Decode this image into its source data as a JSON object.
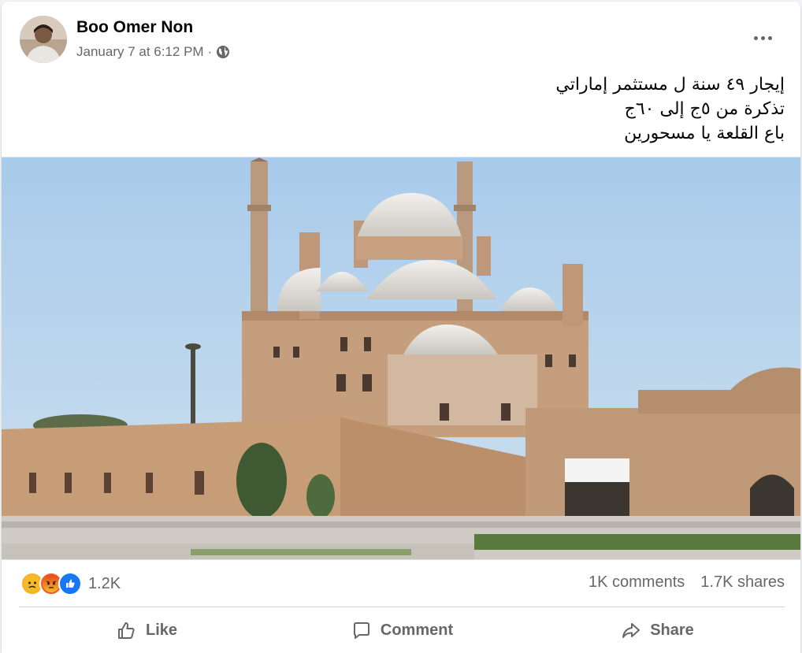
{
  "post": {
    "author": "Boo Omer Non",
    "date": "January 7 at 6:12 PM",
    "separator": "·",
    "privacy_icon": "globe-icon",
    "text_lines": [
      "إيجار ٤٩ سنة ل مستثمر إماراتي",
      "تذكرة من ٥ج إلى ٦٠ج",
      "باع القلعة يا مسحورين"
    ],
    "photo": {
      "subject": "mosque-photo"
    }
  },
  "stats": {
    "reaction_icons": [
      "sad-reaction-icon",
      "angry-reaction-icon",
      "like-reaction-icon"
    ],
    "reaction_count": "1.2K",
    "comments": "1K comments",
    "shares": "1.7K shares"
  },
  "actions": {
    "like": "Like",
    "comment": "Comment",
    "share": "Share"
  },
  "colors": {
    "secondary_text": "#65676b",
    "like_blue": "#1877f2",
    "sky": "#9fc3e4",
    "stone": "#c49a73"
  }
}
